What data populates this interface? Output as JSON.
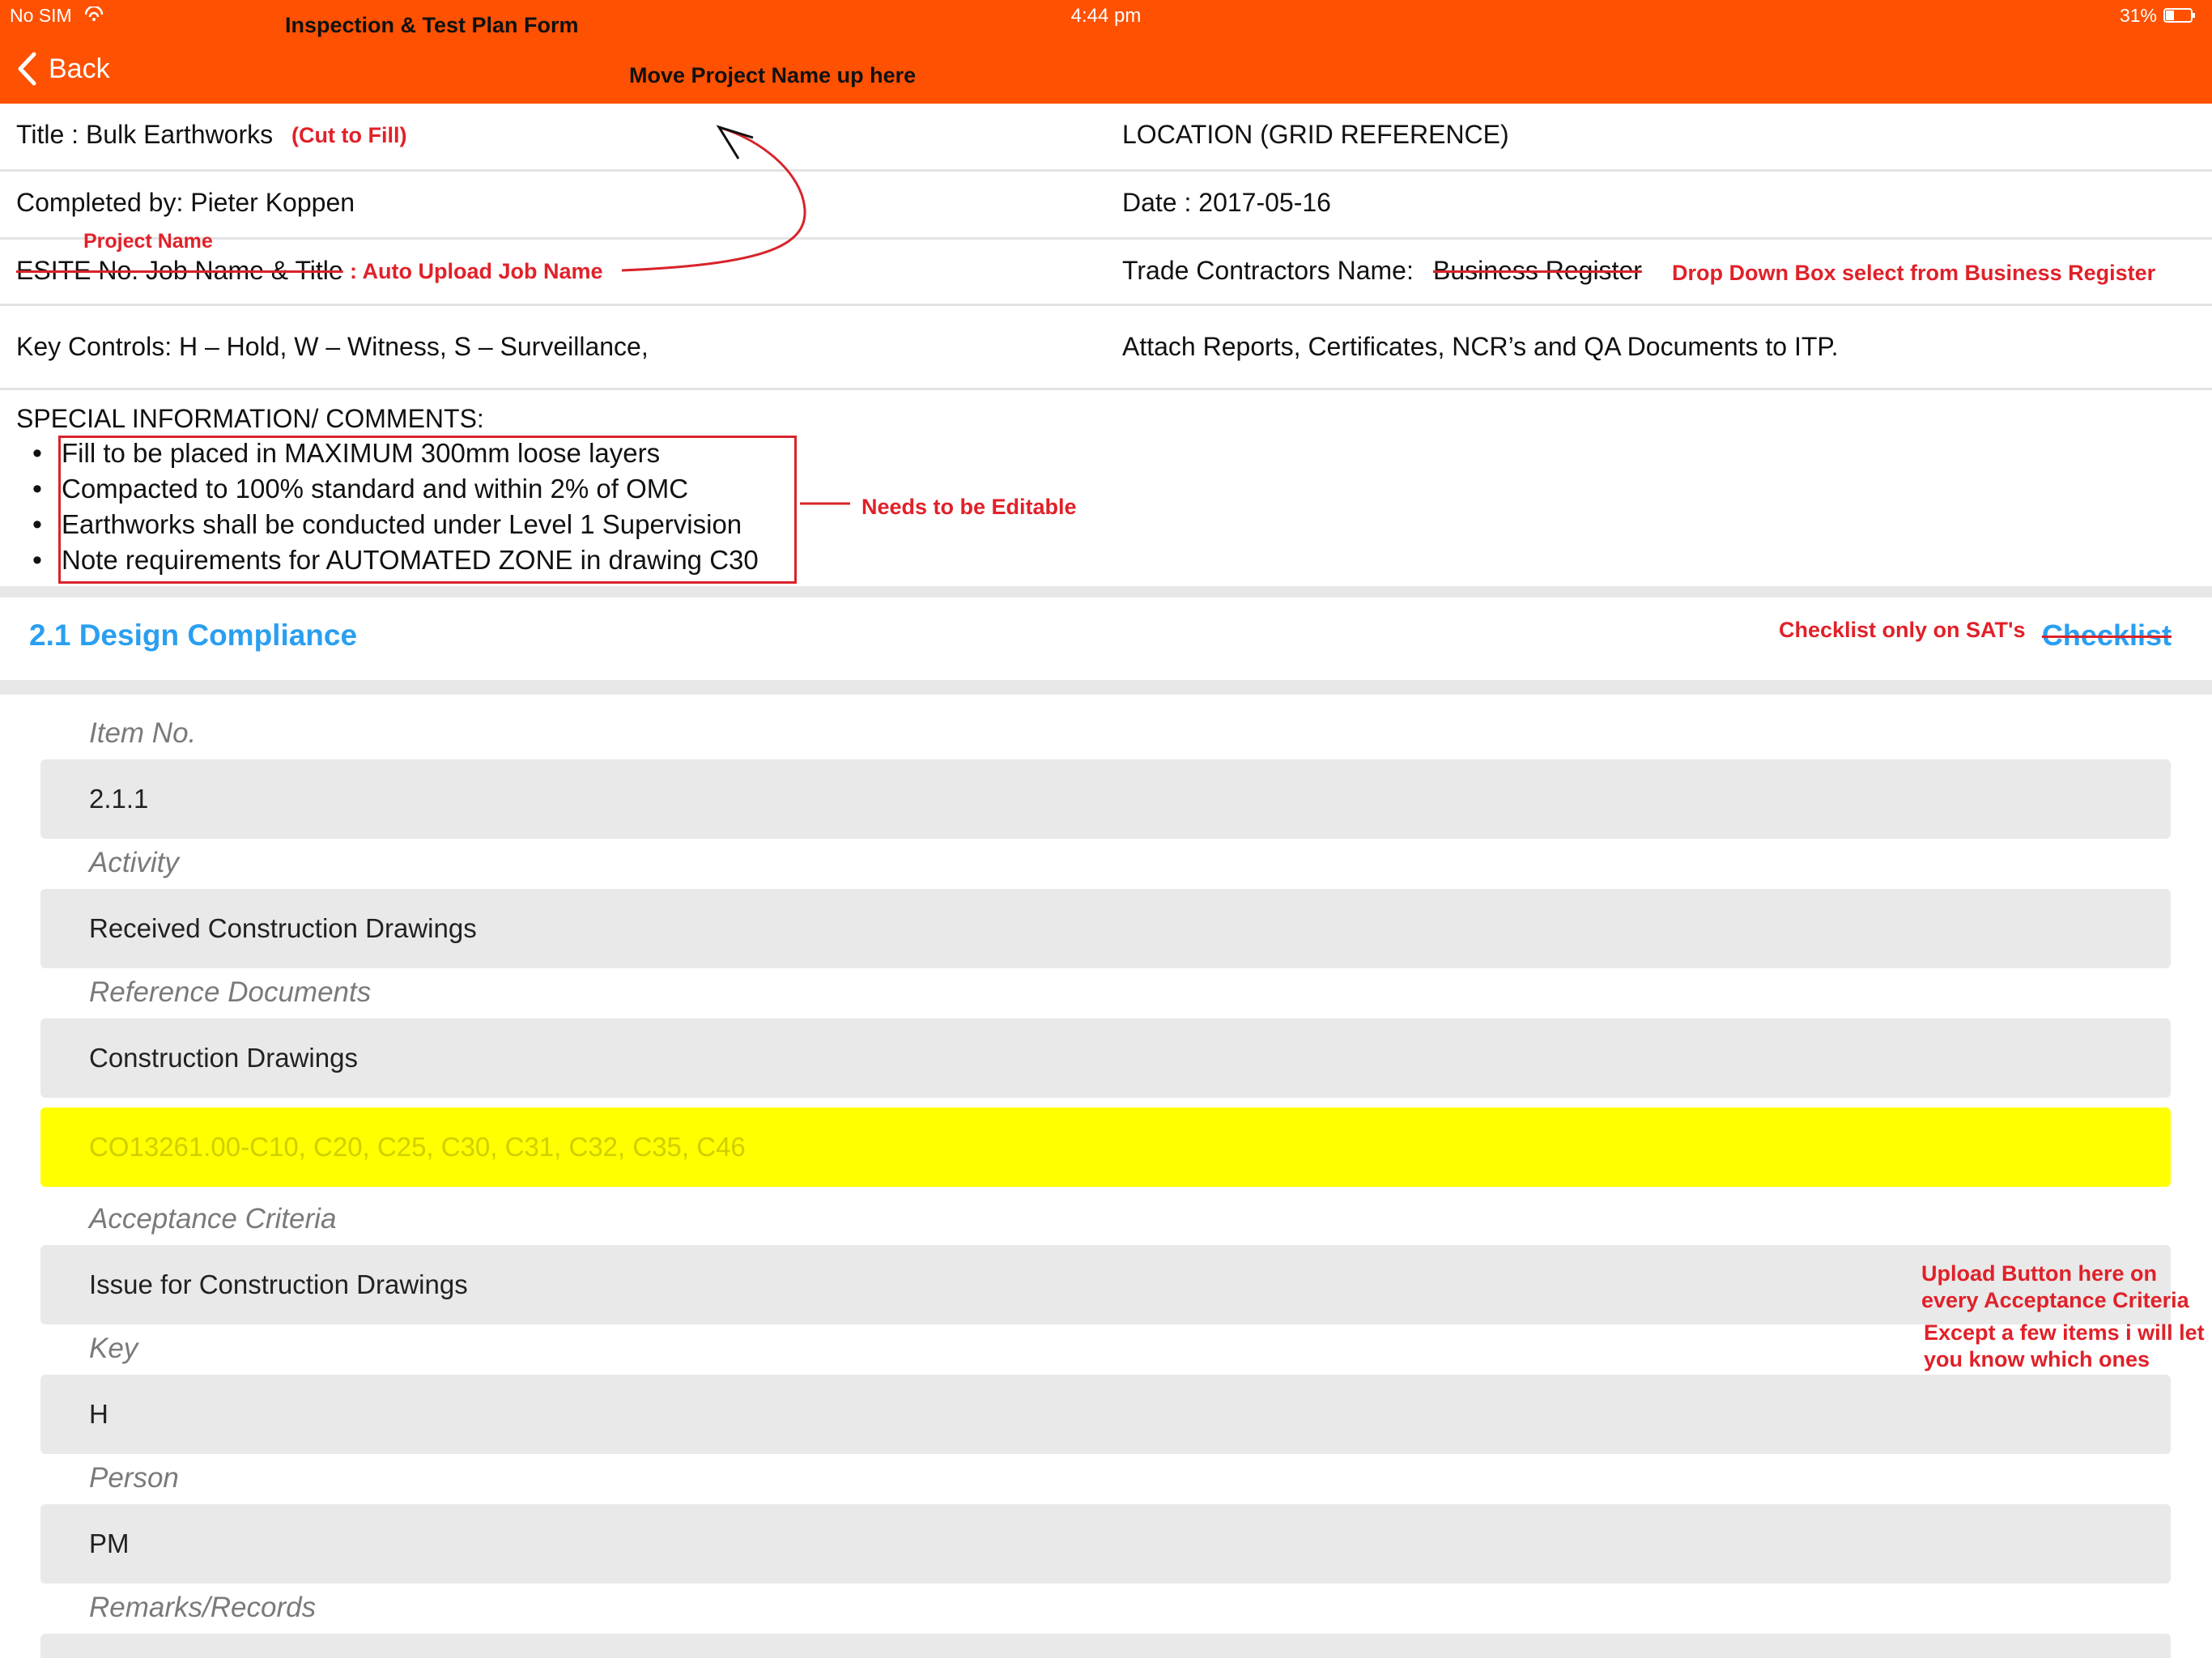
{
  "status": {
    "carrier": "No SIM",
    "time": "4:44 pm",
    "battery": "31%"
  },
  "nav": {
    "back_label": "Back"
  },
  "annotations": {
    "form_title": "Inspection & Test Plan Form",
    "move_project_name": "Move Project Name up here",
    "cut_to_fill": "(Cut to Fill)",
    "project_name": "Project Name",
    "auto_upload": ": Auto Upload Job Name",
    "drop_down": "Drop Down Box select from Business Register",
    "needs_editable": "Needs to be Editable",
    "checklist_only": "Checklist only on SAT's",
    "upload_button_1": "Upload Button here on",
    "upload_button_2": "every Acceptance Criteria",
    "except_1": "Except a few items i will let",
    "except_2": "you know which ones"
  },
  "info": {
    "title": "Title : Bulk Earthworks",
    "location": "LOCATION (GRID REFERENCE)",
    "completed_by": "Completed by: Pieter Koppen",
    "date": "Date : 2017-05-16",
    "esite": "ESITE No. Job Name & Title",
    "trade_label": "Trade Contractors Name:",
    "trade_value": "Business Register",
    "key_controls": "Key Controls: H – Hold, W – Witness, S – Surveillance,",
    "attach": "Attach Reports, Certificates, NCR’s and QA Documents to ITP."
  },
  "special": {
    "heading": "SPECIAL INFORMATION/ COMMENTS:",
    "items": [
      "Fill to be placed in MAXIMUM 300mm loose layers",
      "Compacted to 100% standard and within 2% of OMC",
      "Earthworks shall be conducted under Level 1 Supervision",
      "Note requirements for AUTOMATED ZONE in drawing C30"
    ]
  },
  "section": {
    "title": "2.1 Design Compliance",
    "checklist_label": "Checklist"
  },
  "fields": {
    "item_no_label": "Item No.",
    "item_no_value": "2.1.1",
    "activity_label": "Activity",
    "activity_value": "Received Construction Drawings",
    "refdocs_label": "Reference Documents",
    "refdocs_value": "Construction Drawings",
    "refdocs_extra_placeholder": "CO13261.00-C10, C20, C25, C30, C31, C32, C35, C46",
    "acceptance_label": "Acceptance Criteria",
    "acceptance_value": "Issue for Construction Drawings",
    "key_label": "Key",
    "key_value": "H",
    "person_label": "Person",
    "person_value": "PM",
    "remarks_label": "Remarks/Records"
  },
  "colors": {
    "header": "#fe5101",
    "accent": "#2a9ff0",
    "annotation": "#e02129",
    "highlight": "#ffff00"
  }
}
